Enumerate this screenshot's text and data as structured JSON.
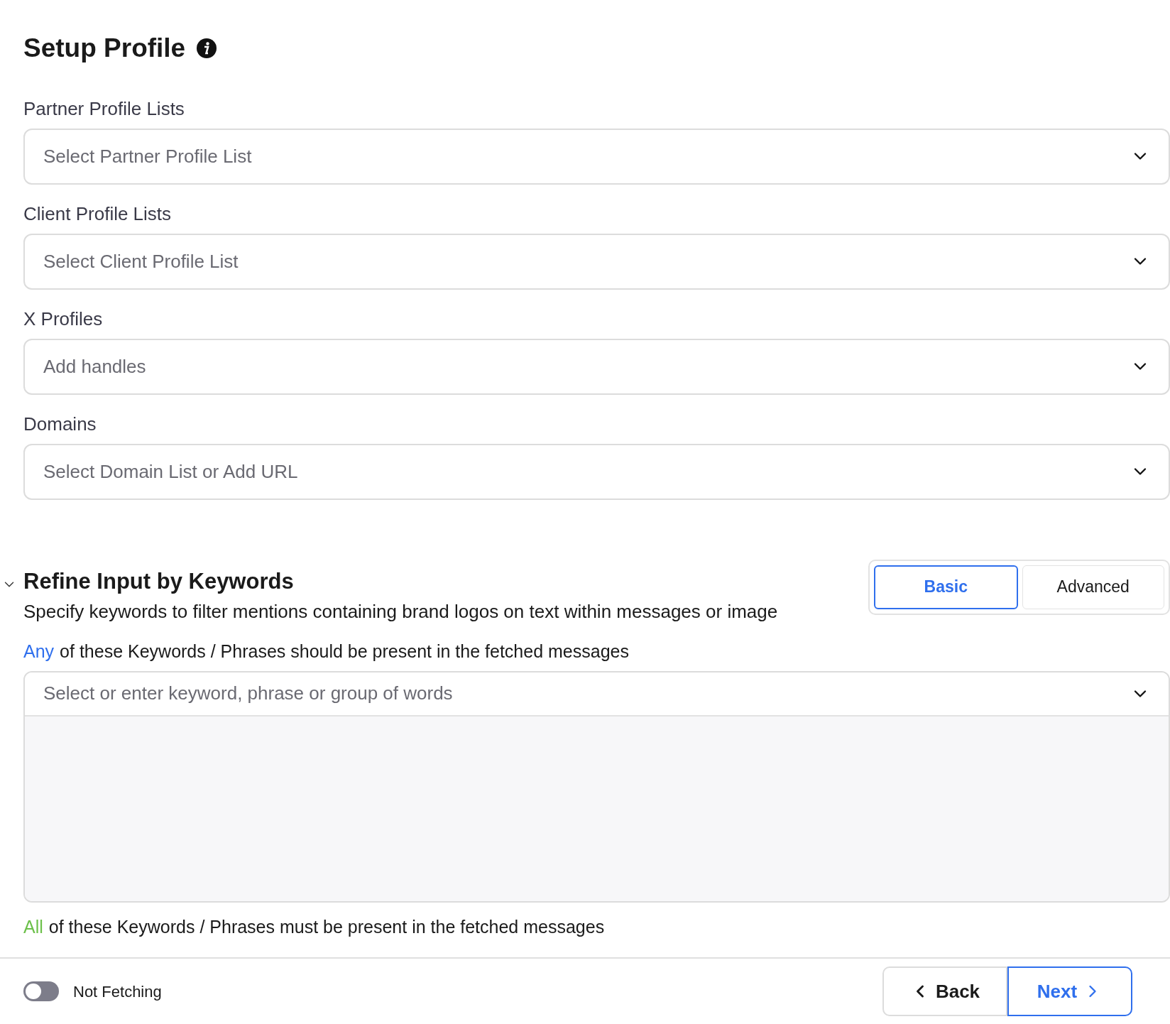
{
  "title": "Setup Profile",
  "fields": [
    {
      "label": "Partner Profile Lists",
      "placeholder": "Select Partner Profile List"
    },
    {
      "label": "Client Profile Lists",
      "placeholder": "Select Client Profile List"
    },
    {
      "label": "X Profiles",
      "placeholder": "Add handles"
    },
    {
      "label": "Domains",
      "placeholder": "Select Domain List or Add URL"
    }
  ],
  "refine": {
    "title": "Refine Input by Keywords",
    "expanded": true,
    "description": "Specify keywords to filter mentions containing brand logos on text within messages or image",
    "modes": [
      {
        "label": "Basic",
        "selected": true
      },
      {
        "label": "Advanced",
        "selected": false
      }
    ],
    "groups": [
      {
        "qualifier": "Any",
        "color": "#2f6fed",
        "text": "of these Keywords / Phrases should be present in the fetched messages",
        "placeholder": "Select or enter keyword, phrase or group of words"
      },
      {
        "qualifier": "All",
        "color": "#6cc04a",
        "text": "of these Keywords / Phrases must be present in the fetched messages"
      }
    ]
  },
  "footer": {
    "fetching": {
      "on": false,
      "label": "Not Fetching"
    },
    "back": "Back",
    "next": "Next"
  }
}
